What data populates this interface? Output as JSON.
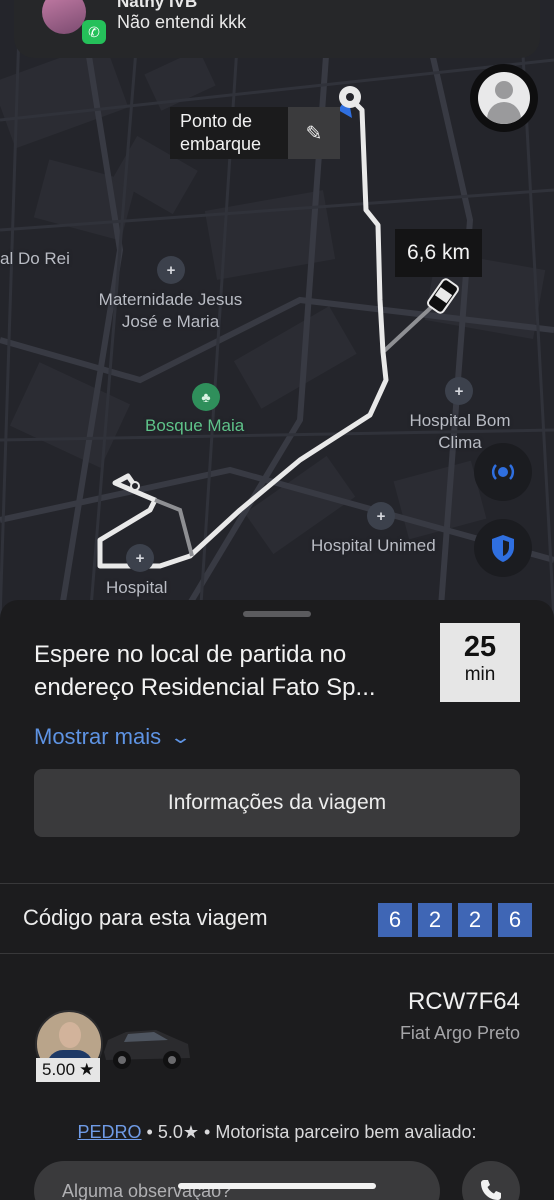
{
  "notification": {
    "sender": "Nathy IVB",
    "message": "Não entendi kkk",
    "app_icon": "whatsapp-icon"
  },
  "map": {
    "pickup_label": "Ponto de embarque",
    "edit_icon": "pencil-icon",
    "distance": "6,6 km",
    "places": {
      "rei": "al Do Rei",
      "maternidade": "Maternidade Jesus José e Maria",
      "bosque": "Bosque Maia",
      "bom_clima": "Hospital Bom Clima",
      "unimed": "Hospital Unimed",
      "hospital": "Hospital"
    },
    "poi_icon": "hospital-icon",
    "park_icon": "tree-icon",
    "buttons": {
      "profile_icon": "person-icon",
      "share_icon": "location-broadcast-icon",
      "safety_icon": "shield-icon"
    },
    "colors": {
      "route": "#e9e9e9",
      "pickup_marker": "#2f6fe0",
      "map_bg": "#24252b"
    }
  },
  "trip": {
    "status_text": "Espere no local de partida no endereço Residencial Fato Sp...",
    "eta_value": "25",
    "eta_unit": "min",
    "show_more": "Mostrar mais",
    "trip_info_button": "Informações da viagem",
    "code_label": "Código para esta viagem",
    "code_digits": [
      "6",
      "2",
      "2",
      "6"
    ],
    "code_color": "#3f66b5"
  },
  "driver": {
    "plate": "RCW7F64",
    "car": "Fiat Argo Preto",
    "rating": "5.00",
    "star": "★",
    "name": "PEDRO",
    "rating_short": "5.0★",
    "description": "Motorista parceiro bem avaliado:",
    "note_placeholder": "Alguma observação?",
    "call_icon": "phone-icon"
  }
}
